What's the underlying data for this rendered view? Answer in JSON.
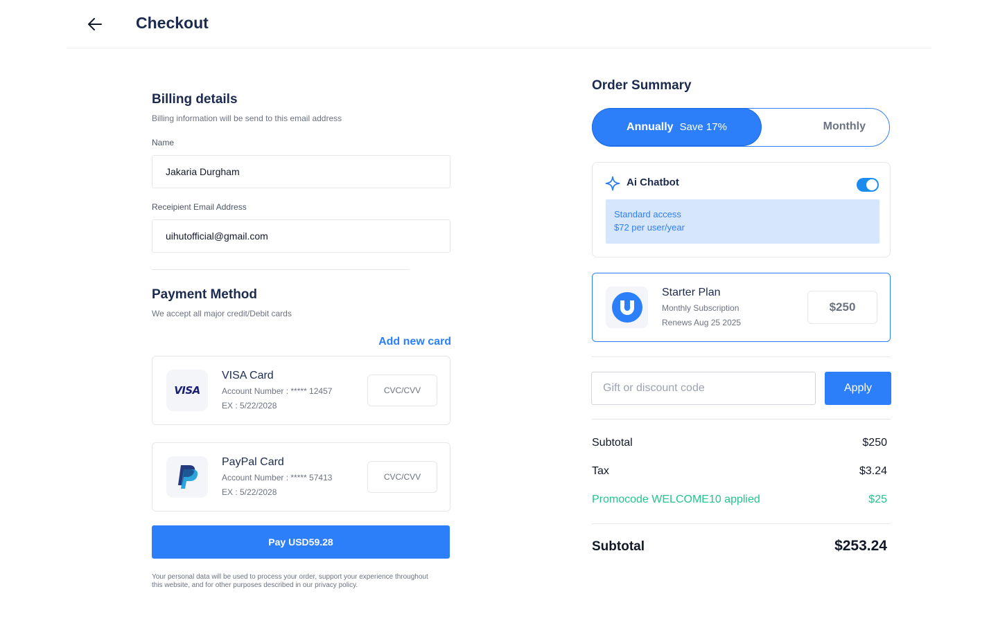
{
  "header": {
    "title": "Checkout",
    "back_icon": "arrow-left-icon"
  },
  "billing": {
    "title": "Billing details",
    "subtitle": "Billing information will be send to this email address",
    "name_label": "Name",
    "name_value": "Jakaria Durgham",
    "email_label": "Receipient Email Address",
    "email_value": "uihutofficial@gmail.com"
  },
  "payment": {
    "title": "Payment Method",
    "subtitle": "We accept all major credit/Debit cards",
    "add_card_label": "Add new card",
    "cards": [
      {
        "logo": "visa-logo",
        "logo_text": "VISA",
        "name": "VISA Card",
        "account": "Account Number : ***** 12457",
        "expiry": "EX : 5/22/2028",
        "cvc_placeholder": "CVC/CVV"
      },
      {
        "logo": "paypal-logo",
        "name": "PayPal Card",
        "account": "Account Number : ***** 57413",
        "expiry": "EX : 5/22/2028",
        "cvc_placeholder": "CVC/CVV"
      }
    ],
    "pay_button": "Pay USD59.28",
    "disclaimer": "Your personal data will be used to process your order, support your experience throughout this website, and for other purposes described in our privacy policy."
  },
  "summary": {
    "title": "Order Summary",
    "billing_toggle": {
      "active_label": "Annually",
      "active_badge": "Save 17%",
      "inactive_label": "Monthly"
    },
    "addon": {
      "icon": "sparkle-icon",
      "title": "Ai Chatbot",
      "enabled": true,
      "access_line1": "Standard access",
      "access_line2": "$72 per user/year"
    },
    "plan": {
      "logo": "uihut-logo",
      "name": "Starter Plan",
      "subtitle": "Monthly Subscription",
      "renews": "Renews Aug 25 2025",
      "price": "$250"
    },
    "gift": {
      "placeholder": "Gift or discount code",
      "apply_label": "Apply"
    },
    "lines": [
      {
        "label": "Subtotal",
        "value": "$250"
      },
      {
        "label": "Tax",
        "value": "$3.24"
      },
      {
        "label": "Promocode WELCOME10 applied",
        "value": "$25"
      }
    ],
    "total": {
      "label": "Subtotal",
      "value": "$253.24"
    },
    "colors": {
      "accent": "#2d7ff9",
      "promo": "#23c48e",
      "navy": "#1b2a4e"
    }
  }
}
